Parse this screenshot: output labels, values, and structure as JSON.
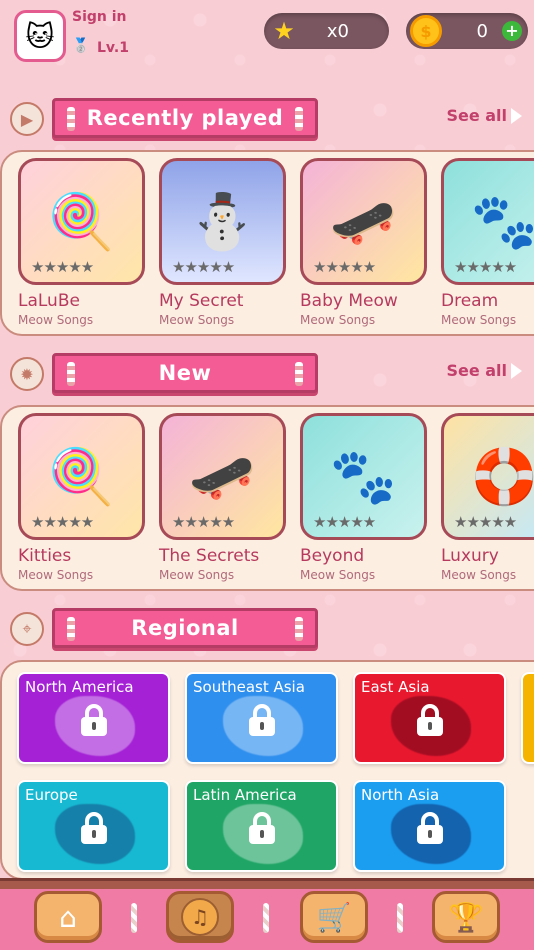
{
  "header": {
    "sign_in": "Sign in",
    "level": "Lv.1",
    "stars": "x0",
    "coins": "0",
    "avatar_icon": "cat-face-icon",
    "medal_icon": "medal-icon",
    "star_icon": "star-icon",
    "coin_icon": "coin-icon",
    "plus_icon": "plus-icon"
  },
  "recently_played": {
    "title": "Recently played",
    "see_all": "See all",
    "items": [
      {
        "title": "LaLuBe",
        "sub": "Meow Songs",
        "stars": "★★★★★",
        "rating": 0
      },
      {
        "title": "My Secret",
        "sub": "Meow Songs",
        "stars": "★★★★★",
        "rating": 0
      },
      {
        "title": "Baby Meow",
        "sub": "Meow Songs",
        "stars": "★★★★★",
        "rating": 0
      },
      {
        "title": "Dream",
        "sub": "Meow Songs",
        "stars": "★★★★★",
        "rating": 0
      }
    ]
  },
  "new": {
    "title": "New",
    "see_all": "See all",
    "items": [
      {
        "title": "Kitties",
        "sub": "Meow Songs",
        "stars": "★★★★★",
        "rating": 0
      },
      {
        "title": "The Secrets",
        "sub": "Meow Songs",
        "stars": "★★★★★",
        "rating": 0
      },
      {
        "title": "Beyond",
        "sub": "Meow Songs",
        "stars": "★★★★★",
        "rating": 0
      },
      {
        "title": "Luxury",
        "sub": "Meow Songs",
        "stars": "★★★★★",
        "rating": 0
      }
    ]
  },
  "regional": {
    "title": "Regional",
    "tiles": [
      {
        "name": "North America",
        "color": "#a421d6",
        "locked": true
      },
      {
        "name": "Southeast Asia",
        "color": "#2f8fee",
        "locked": true
      },
      {
        "name": "East Asia",
        "color": "#e8182f",
        "locked": true
      },
      {
        "name": "",
        "color": "#f5b400",
        "locked": true
      },
      {
        "name": "Europe",
        "color": "#17b9d2",
        "locked": true
      },
      {
        "name": "Latin America",
        "color": "#1fa565",
        "locked": true
      },
      {
        "name": "North Asia",
        "color": "#1c9ef0",
        "locked": true
      }
    ]
  },
  "nav": {
    "items": [
      "home-icon",
      "music-note-icon",
      "shopping-cart-icon",
      "trophy-icon"
    ],
    "active": 1
  }
}
